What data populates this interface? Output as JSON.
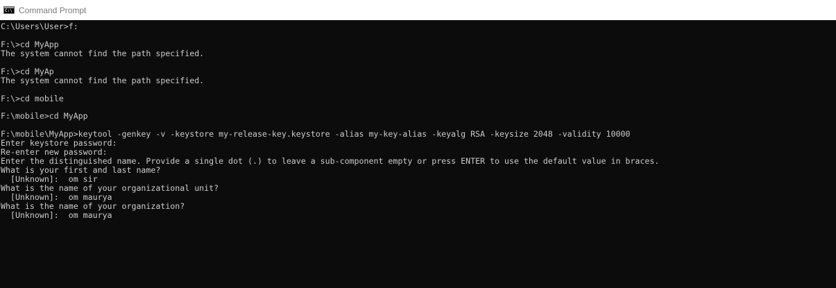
{
  "window": {
    "title": "Command Prompt",
    "icon": "console-app-icon",
    "icon_glyph": "C:\\"
  },
  "console": {
    "lines": [
      "C:\\Users\\User>f:",
      "",
      "F:\\>cd MyApp",
      "The system cannot find the path specified.",
      "",
      "F:\\>cd MyAp",
      "The system cannot find the path specified.",
      "",
      "F:\\>cd mobile",
      "",
      "F:\\mobile>cd MyApp",
      "",
      "F:\\mobile\\MyApp>keytool -genkey -v -keystore my-release-key.keystore -alias my-key-alias -keyalg RSA -keysize 2048 -validity 10000",
      "Enter keystore password:",
      "Re-enter new password:",
      "Enter the distinguished name. Provide a single dot (.) to leave a sub-component empty or press ENTER to use the default value in braces.",
      "What is your first and last name?",
      "  [Unknown]:  om sir",
      "What is the name of your organizational unit?",
      "  [Unknown]:  om maurya",
      "What is the name of your organization?",
      "  [Unknown]:  om maurya"
    ]
  },
  "colors": {
    "console_background": "#0c0c0c",
    "console_text": "#cccccc",
    "titlebar_background": "#ffffff",
    "titlebar_text": "#7a7a7a"
  }
}
